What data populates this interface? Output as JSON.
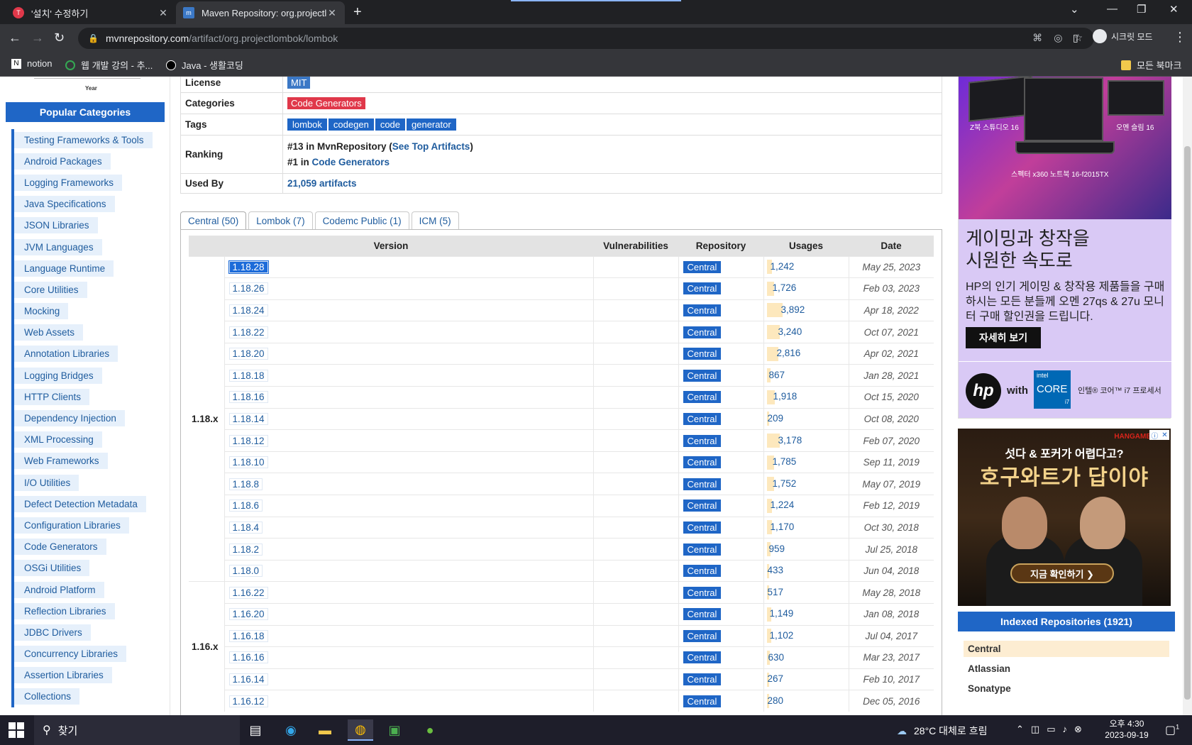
{
  "browser": {
    "tabs": [
      {
        "title": "'설치' 수정하기",
        "active": false,
        "favicon_color": "#e0384a"
      },
      {
        "title": "Maven Repository: org.projectlombok",
        "active": true,
        "favicon_color": "#3b78c6"
      }
    ],
    "url_host": "mvnrepository.com",
    "url_path": "/artifact/org.projectlombok/lombok",
    "profile_label": "시크릿 모드",
    "bookmarks": [
      "notion",
      "웹 개발 강의 - 추...",
      "Java - 생활코딩"
    ],
    "all_bookmarks": "모든 북마크"
  },
  "sidebar": {
    "chart_xlabel": "Year",
    "heading": "Popular Categories",
    "categories": [
      "Testing Frameworks & Tools",
      "Android Packages",
      "Logging Frameworks",
      "Java Specifications",
      "JSON Libraries",
      "JVM Languages",
      "Language Runtime",
      "Core Utilities",
      "Mocking",
      "Web Assets",
      "Annotation Libraries",
      "Logging Bridges",
      "HTTP Clients",
      "Dependency Injection",
      "XML Processing",
      "Web Frameworks",
      "I/O Utilities",
      "Defect Detection Metadata",
      "Configuration Libraries",
      "Code Generators",
      "OSGi Utilities",
      "Android Platform",
      "Reflection Libraries",
      "JDBC Drivers",
      "Concurrency Libraries",
      "Assertion Libraries",
      "Collections"
    ]
  },
  "info": {
    "license_label": "License",
    "license": "MIT",
    "categories_label": "Categories",
    "category": "Code Generators",
    "tags_label": "Tags",
    "tags": [
      "lombok",
      "codegen",
      "code",
      "generator"
    ],
    "ranking_label": "Ranking",
    "rank1_prefix": "#13 in MvnRepository (",
    "rank1_link": "See Top Artifacts",
    "rank1_suffix": ")",
    "rank2_prefix": "#1 in ",
    "rank2_link": "Code Generators",
    "used_by_label": "Used By",
    "used_by": "21,059 artifacts"
  },
  "repo_tabs": [
    "Central (50)",
    "Lombok (7)",
    "Codemc Public (1)",
    "ICM (5)"
  ],
  "table": {
    "headers": {
      "version": "Version",
      "vulnerabilities": "Vulnerabilities",
      "repository": "Repository",
      "usages": "Usages",
      "date": "Date"
    },
    "groups": [
      {
        "label": "1.18.x",
        "rows": [
          {
            "version": "1.18.28",
            "repo": "Central",
            "usages": "1,242",
            "usage_value": 1242,
            "date": "May 25, 2023"
          },
          {
            "version": "1.18.26",
            "repo": "Central",
            "usages": "1,726",
            "usage_value": 1726,
            "date": "Feb 03, 2023"
          },
          {
            "version": "1.18.24",
            "repo": "Central",
            "usages": "3,892",
            "usage_value": 3892,
            "date": "Apr 18, 2022"
          },
          {
            "version": "1.18.22",
            "repo": "Central",
            "usages": "3,240",
            "usage_value": 3240,
            "date": "Oct 07, 2021"
          },
          {
            "version": "1.18.20",
            "repo": "Central",
            "usages": "2,816",
            "usage_value": 2816,
            "date": "Apr 02, 2021"
          },
          {
            "version": "1.18.18",
            "repo": "Central",
            "usages": "867",
            "usage_value": 867,
            "date": "Jan 28, 2021"
          },
          {
            "version": "1.18.16",
            "repo": "Central",
            "usages": "1,918",
            "usage_value": 1918,
            "date": "Oct 15, 2020"
          },
          {
            "version": "1.18.14",
            "repo": "Central",
            "usages": "209",
            "usage_value": 209,
            "date": "Oct 08, 2020"
          },
          {
            "version": "1.18.12",
            "repo": "Central",
            "usages": "3,178",
            "usage_value": 3178,
            "date": "Feb 07, 2020"
          },
          {
            "version": "1.18.10",
            "repo": "Central",
            "usages": "1,785",
            "usage_value": 1785,
            "date": "Sep 11, 2019"
          },
          {
            "version": "1.18.8",
            "repo": "Central",
            "usages": "1,752",
            "usage_value": 1752,
            "date": "May 07, 2019"
          },
          {
            "version": "1.18.6",
            "repo": "Central",
            "usages": "1,224",
            "usage_value": 1224,
            "date": "Feb 12, 2019"
          },
          {
            "version": "1.18.4",
            "repo": "Central",
            "usages": "1,170",
            "usage_value": 1170,
            "date": "Oct 30, 2018"
          },
          {
            "version": "1.18.2",
            "repo": "Central",
            "usages": "959",
            "usage_value": 959,
            "date": "Jul 25, 2018"
          },
          {
            "version": "1.18.0",
            "repo": "Central",
            "usages": "433",
            "usage_value": 433,
            "date": "Jun 04, 2018"
          }
        ]
      },
      {
        "label": "1.16.x",
        "rows": [
          {
            "version": "1.16.22",
            "repo": "Central",
            "usages": "517",
            "usage_value": 517,
            "date": "May 28, 2018"
          },
          {
            "version": "1.16.20",
            "repo": "Central",
            "usages": "1,149",
            "usage_value": 1149,
            "date": "Jan 08, 2018"
          },
          {
            "version": "1.16.18",
            "repo": "Central",
            "usages": "1,102",
            "usage_value": 1102,
            "date": "Jul 04, 2017"
          },
          {
            "version": "1.16.16",
            "repo": "Central",
            "usages": "630",
            "usage_value": 630,
            "date": "Mar 23, 2017"
          },
          {
            "version": "1.16.14",
            "repo": "Central",
            "usages": "267",
            "usage_value": 267,
            "date": "Feb 10, 2017"
          },
          {
            "version": "1.16.12",
            "repo": "Central",
            "usages": "280",
            "usage_value": 280,
            "date": "Dec 05, 2016"
          }
        ]
      }
    ]
  },
  "ads": {
    "hp_caption_left": "Z북 스튜디오 16",
    "hp_caption_right": "오멘 슬림 16",
    "hp_caption_bottom": "스펙터 x360 노트북 16-f2015TX",
    "hp_headline_1": "게이밍과 창작을",
    "hp_headline_2": "시원한 속도로",
    "hp_body": "HP의 인기 게이밍 & 창작용 제품들을 구매하시는 모든 분들께 오멘 27qs & 27u 모니터 구매 할인권을 드립니다.",
    "hp_cta": "자세히 보기",
    "hp_logo": "hp",
    "hp_with": "with",
    "intel_l1": "intel",
    "intel_l2": "CORE",
    "intel_l3": "i7",
    "intel_text": "인텔® 코어™ i7 프로세서",
    "game_brand": "HANGAME",
    "game_line1": "섯다 & 포커가 어렵다고?",
    "game_line2": "호구와트가 답이야",
    "game_cta": "지금 확인하기 ❯"
  },
  "indexed": {
    "heading": "Indexed Repositories (1921)",
    "items": [
      "Central",
      "Atlassian",
      "Sonatype"
    ]
  },
  "taskbar": {
    "search_placeholder": "찾기",
    "weather": "28°C 대체로 흐림",
    "time": "오후 4:30",
    "date": "2023-09-19",
    "notif_count": "1"
  },
  "colors": {
    "accent": "#1f66c6",
    "red_badge": "#e0384a",
    "usage_bar": "#fde8bd"
  }
}
